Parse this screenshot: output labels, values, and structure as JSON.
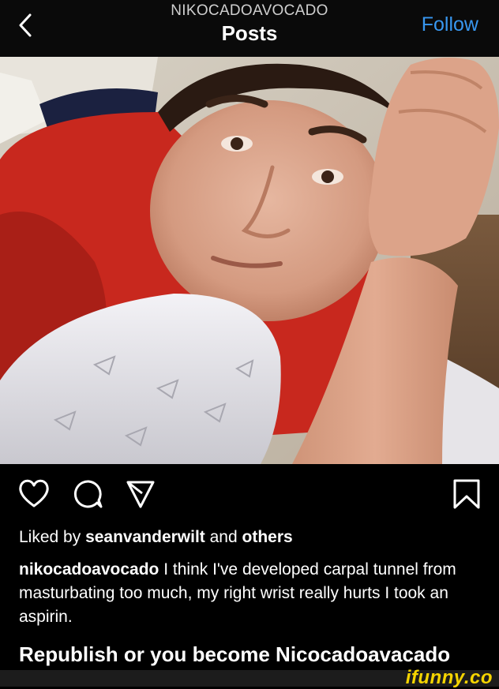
{
  "header": {
    "username": "NIKOCADOAVOCADO",
    "title": "Posts",
    "follow_label": "Follow",
    "back_icon": "chevron-left-icon"
  },
  "photo": {
    "description_colors": {
      "shirt": "#c8281e",
      "pillow": "#e9e8ec",
      "skin": "#d9a48a",
      "wall": "#d7cfc2"
    }
  },
  "actions": {
    "icons": [
      "heart-icon",
      "comment-icon",
      "share-icon",
      "bookmark-icon"
    ]
  },
  "likes": {
    "prefix": "Liked by ",
    "user": "seanvanderwilt",
    "middle": " and ",
    "others": "others"
  },
  "caption": {
    "user": "nikocadoavocado",
    "text": " I think I've developed carpal tunnel from masturbating too much, my right wrist really hurts I took an aspirin."
  },
  "meme_caption": "Republish or you become Nicocadoavacado",
  "watermark": {
    "logo": "ifunny.co",
    "color": "#f5d400"
  },
  "colors": {
    "accent": "#3897f0",
    "background": "#000000"
  }
}
